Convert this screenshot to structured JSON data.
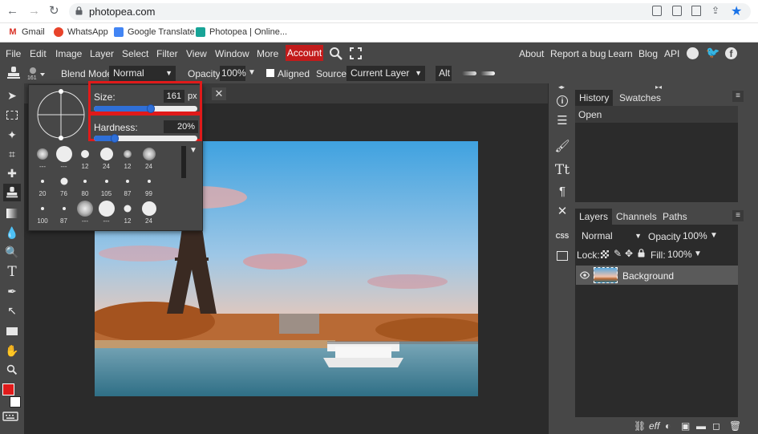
{
  "browser": {
    "url": "photopea.com",
    "bookmarks": [
      {
        "label": "Gmail",
        "icon": "gmail-icon",
        "color": "#d93025"
      },
      {
        "label": "WhatsApp",
        "icon": "whatsapp-icon",
        "color": "#e8432a"
      },
      {
        "label": "Google Translate",
        "icon": "google-translate-icon",
        "color": "#4285f4"
      },
      {
        "label": "Photopea | Online...",
        "icon": "photopea-icon",
        "color": "#18a497"
      }
    ]
  },
  "menubar": {
    "items": [
      "File",
      "Edit",
      "Image",
      "Layer",
      "Select",
      "Filter",
      "View",
      "Window",
      "More"
    ],
    "account": "Account",
    "right_items": [
      "About",
      "Report a bug",
      "Learn",
      "Blog",
      "API"
    ]
  },
  "options": {
    "blend_mode_label": "Blend Mode:",
    "blend_mode_value": "Normal",
    "opacity_label": "Opacity:",
    "opacity_value": "100%",
    "aligned_label": "Aligned",
    "source_label": "Source:",
    "source_value": "Current Layer",
    "alt_label": "Alt",
    "brush_size_indicator": "161"
  },
  "brush_popup": {
    "size_label": "Size:",
    "size_value": "161",
    "size_unit": "px",
    "size_fraction": 0.55,
    "hardness_label": "Hardness:",
    "hardness_value": "20%",
    "hardness_fraction": 0.2,
    "presets": [
      {
        "label": "---",
        "d": 14,
        "soft": true
      },
      {
        "label": "---",
        "d": 20,
        "soft": false
      },
      {
        "label": "12",
        "d": 10,
        "soft": false
      },
      {
        "label": "24",
        "d": 16,
        "soft": false
      },
      {
        "label": "12",
        "d": 10,
        "soft": true
      },
      {
        "label": "24",
        "d": 16,
        "soft": true
      },
      {
        "label": "20",
        "d": 4,
        "soft": false
      },
      {
        "label": "76",
        "d": 9,
        "soft": false
      },
      {
        "label": "80",
        "d": 4,
        "soft": false
      },
      {
        "label": "105",
        "d": 4,
        "soft": false
      },
      {
        "label": "87",
        "d": 4,
        "soft": false
      },
      {
        "label": "99",
        "d": 4,
        "soft": false
      },
      {
        "label": "100",
        "d": 4,
        "soft": false
      },
      {
        "label": "87",
        "d": 4,
        "soft": false
      },
      {
        "label": "---",
        "d": 20,
        "soft": true
      },
      {
        "label": "---",
        "d": 20,
        "soft": false
      },
      {
        "label": "12",
        "d": 9,
        "soft": false
      },
      {
        "label": "24",
        "d": 18,
        "soft": false
      }
    ]
  },
  "history_panel": {
    "tabs": [
      "History",
      "Swatches"
    ],
    "entries": [
      "Open"
    ]
  },
  "layers_panel": {
    "tabs": [
      "Layers",
      "Channels",
      "Paths"
    ],
    "blend_value": "Normal",
    "opacity_label": "Opacity:",
    "opacity_value": "100%",
    "lock_label": "Lock:",
    "fill_label": "Fill:",
    "fill_value": "100%",
    "layers": [
      {
        "name": "Background"
      }
    ],
    "bottom_label": "eff"
  },
  "side_icons": {
    "css_label": "CSS"
  },
  "colors": {
    "foreground": "#e01a1a",
    "background": "#ffffff",
    "highlight": "#e01a1a",
    "slider": "#2f6fd7",
    "accent_blue": "#1a73e8"
  }
}
